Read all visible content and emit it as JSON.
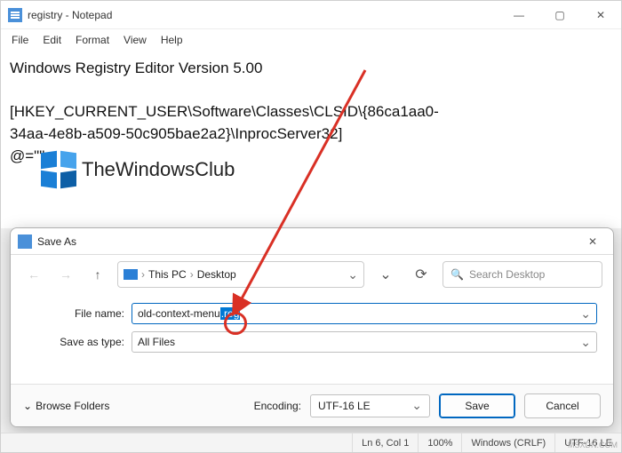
{
  "window": {
    "title": "registry - Notepad",
    "menu": {
      "file": "File",
      "edit": "Edit",
      "format": "Format",
      "view": "View",
      "help": "Help"
    }
  },
  "document": {
    "line1": "Windows Registry Editor Version 5.00",
    "line2a": "[HKEY_CURRENT_USER\\Software\\Classes\\CLSID\\{86ca1aa0-",
    "line2b": "34aa-4e8b-a509-50c905bae2a2}\\InprocServer32]",
    "line3": "@=\"\""
  },
  "logo": {
    "text": "TheWindowsClub"
  },
  "dialog": {
    "title": "Save As",
    "breadcrumb": {
      "root": "This PC",
      "folder": "Desktop"
    },
    "search_placeholder": "Search Desktop",
    "filename_label": "File name:",
    "filename_prefix": "old-context-menu",
    "filename_selected": ".reg",
    "type_label": "Save as type:",
    "type_value": "All Files",
    "browse": "Browse Folders",
    "encoding_label": "Encoding:",
    "encoding_value": "UTF-16 LE",
    "save": "Save",
    "cancel": "Cancel"
  },
  "status": {
    "pos": "Ln 6, Col 1",
    "zoom": "100%",
    "eol": "Windows (CRLF)",
    "enc": "UTF-16 LE"
  },
  "watermark": "MSXDN.COM"
}
